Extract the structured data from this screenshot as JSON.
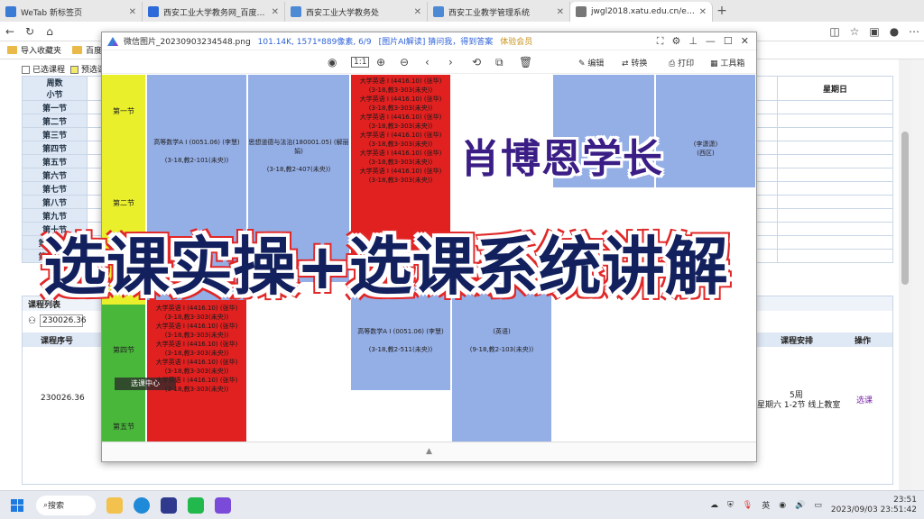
{
  "browser": {
    "tabs": [
      {
        "title": "WeTab 新标签页",
        "color": "#3a7bd5"
      },
      {
        "title": "西安工业大学教务网_百度搜索",
        "color": "#2c6ad9"
      },
      {
        "title": "西安工业大学教务处",
        "color": "#4d8ad6"
      },
      {
        "title": "西安工业教学管理系统",
        "color": "#4d8ad6"
      },
      {
        "title": "jwgl2018.xatu.edu.cn/eams/stdT",
        "color": "#555555"
      }
    ],
    "bookmarks": [
      "导入收藏夹",
      "百度"
    ]
  },
  "page": {
    "filters": [
      "已选课程",
      "预选课"
    ],
    "week_header": "周数",
    "section_header": "小节",
    "sunday": "星期日",
    "sections": [
      "第一节",
      "第二节",
      "第三节",
      "第四节",
      "第五节",
      "第六节",
      "第七节",
      "第八节",
      "第九节",
      "第十节",
      "第十一节",
      "第十二节"
    ],
    "lower": {
      "panel_title": "课程列表",
      "search_value": "230026.36",
      "columns": [
        "课程序号",
        "课程安排",
        "操作"
      ],
      "row": {
        "code": "230026.36",
        "week": "5周",
        "schedule": "星期六 1-2节 线上教室",
        "action": "选课"
      }
    }
  },
  "viewer": {
    "filename": "微信图片_20230903234548.png",
    "meta": "101.14K, 1571*889像素, 6/9",
    "ai_prompt": "[图片AI解读] 猜问我，得到答案",
    "vip": "体验会员",
    "tools": {
      "edit": "编辑",
      "convert": "转换",
      "print": "打印",
      "toolbox": "工具箱"
    },
    "scale_label": "1:1",
    "footer": "▲",
    "timetable": {
      "sections": [
        "第一节",
        "第二节",
        "第四节",
        "第五节"
      ],
      "course1": {
        "name": "高等数学A I (0051.06) (李慧)",
        "time": "(3-18,教2-101(未央))"
      },
      "course2": {
        "name": "思想道德与法治(180001.05) (解丽娟)",
        "time": "(3-18,教2-407(未央))"
      },
      "course3": {
        "name": "高等数学A I (0051.06) (李慧)",
        "time": "(3-18,教2-511(未央))"
      },
      "course4": {
        "name": "(英语)",
        "time": "(9-18,教2-103(未央))"
      },
      "right_course": {
        "name": "(李潇潇)",
        "place": "(西区)"
      },
      "red_line": "大学英语 I (4416.10) (张华)",
      "red_time": "(3-18,教3-303(未央))",
      "collapse": "选课中心"
    }
  },
  "overlay": {
    "title1": "肖博恩学长",
    "title2": "选课实操+选课系统讲解"
  },
  "taskbar": {
    "search": "搜索",
    "ime": "英",
    "time": "23:51",
    "date": "2023/09/03 23:51:42"
  }
}
